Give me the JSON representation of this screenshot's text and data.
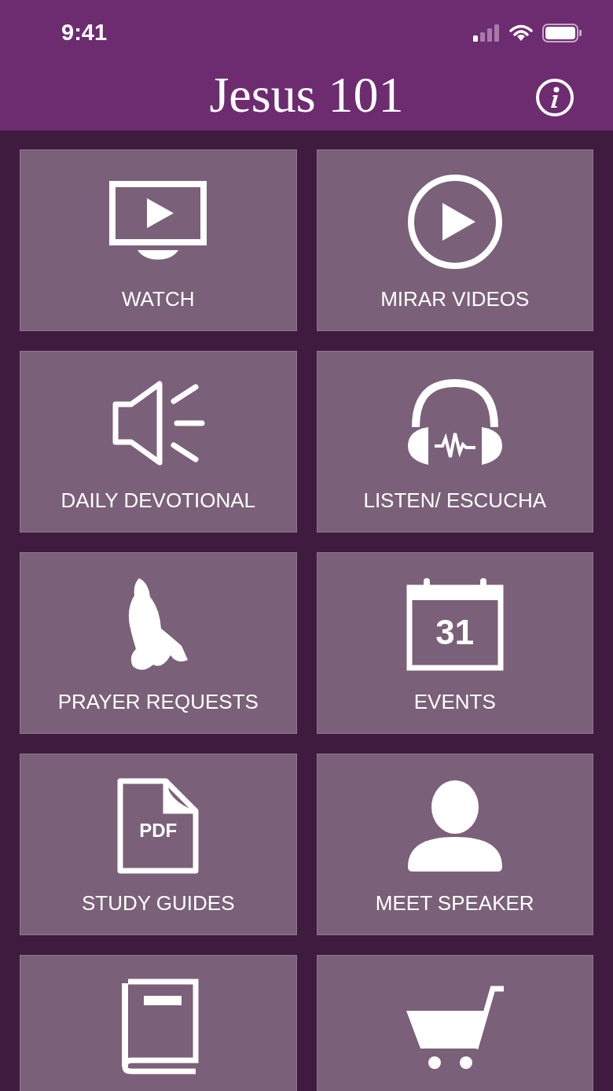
{
  "status_bar": {
    "time": "9:41"
  },
  "header": {
    "logo": "Jesus 101"
  },
  "rows": [
    {
      "left": {
        "kind": "tv",
        "label": "WATCH"
      },
      "right": {
        "kind": "play",
        "label": "MIRAR VIDEOS"
      }
    },
    {
      "left": {
        "kind": "speaker",
        "label": "DAILY DEVOTIONAL"
      },
      "right": {
        "kind": "headphones",
        "label": "LISTEN/ ESCUCHA"
      }
    },
    {
      "left": {
        "kind": "prayer",
        "label": "PRAYER REQUESTS"
      },
      "right": {
        "kind": "calendar",
        "label": "EVENTS",
        "icon_text": "31"
      }
    },
    {
      "left": {
        "kind": "pdf",
        "label": "STUDY GUIDES",
        "icon_text": "PDF"
      },
      "right": {
        "kind": "person",
        "label": "MEET SPEAKER"
      }
    },
    {
      "left": {
        "kind": "book"
      },
      "right": {
        "kind": "cart"
      }
    }
  ]
}
